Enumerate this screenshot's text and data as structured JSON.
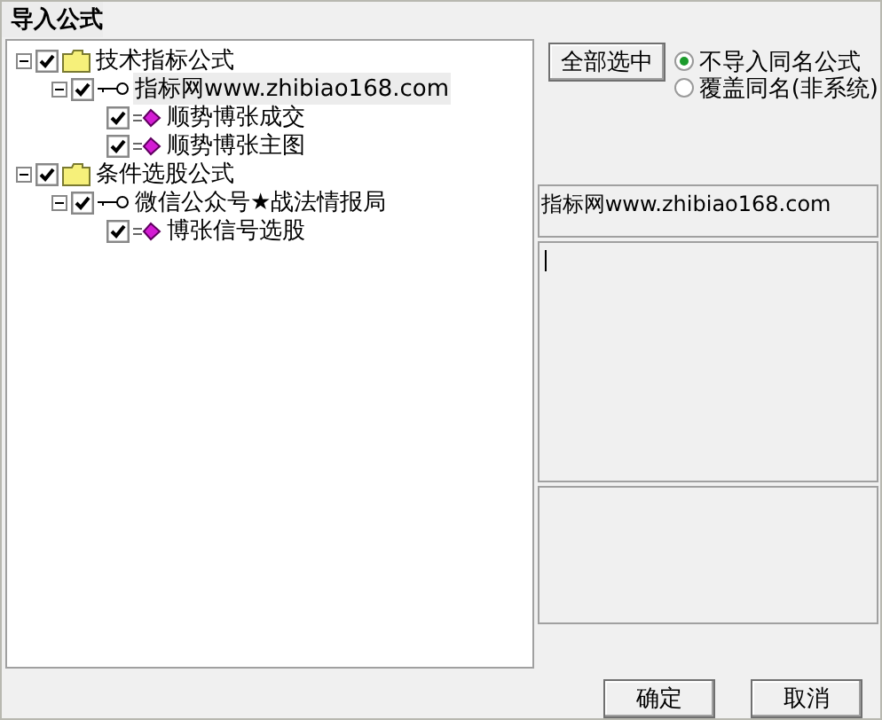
{
  "window": {
    "title": "导入公式"
  },
  "tree": [
    {
      "kind": "folder",
      "label": "技术指标公式",
      "checked": true,
      "expanded": true,
      "selected": false,
      "children": [
        {
          "kind": "group",
          "label": "指标网www.zhibiao168.com",
          "checked": true,
          "expanded": true,
          "selected": true,
          "children": [
            {
              "kind": "formula",
              "label": "顺势博张成交",
              "checked": true,
              "selected": false
            },
            {
              "kind": "formula",
              "label": "顺势博张主图",
              "checked": true,
              "selected": false
            }
          ]
        }
      ]
    },
    {
      "kind": "folder",
      "label": "条件选股公式",
      "checked": true,
      "expanded": true,
      "selected": false,
      "children": [
        {
          "kind": "group",
          "label": "微信公众号★战法情报局",
          "checked": true,
          "expanded": true,
          "selected": false,
          "children": [
            {
              "kind": "formula",
              "label": "博张信号选股",
              "checked": true,
              "selected": false
            }
          ]
        }
      ]
    }
  ],
  "select_all_button": "全部选中",
  "options": [
    {
      "label": "不导入同名公式",
      "selected": true
    },
    {
      "label": "覆盖同名(非系统)",
      "selected": false
    }
  ],
  "info_field": {
    "value": "指标网www.zhibiao168.com"
  },
  "buttons": [
    "确定",
    "取消"
  ]
}
